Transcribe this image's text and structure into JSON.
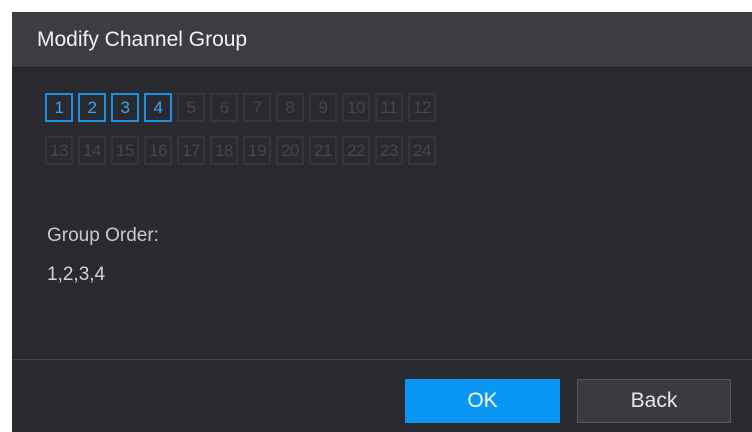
{
  "dialog": {
    "title": "Modify Channel Group"
  },
  "channels": {
    "row1": [
      {
        "label": "1",
        "selected": true
      },
      {
        "label": "2",
        "selected": true
      },
      {
        "label": "3",
        "selected": true
      },
      {
        "label": "4",
        "selected": true
      },
      {
        "label": "5",
        "selected": false
      },
      {
        "label": "6",
        "selected": false
      },
      {
        "label": "7",
        "selected": false
      },
      {
        "label": "8",
        "selected": false
      },
      {
        "label": "9",
        "selected": false
      },
      {
        "label": "10",
        "selected": false
      },
      {
        "label": "11",
        "selected": false
      },
      {
        "label": "12",
        "selected": false
      }
    ],
    "row2": [
      {
        "label": "13",
        "selected": false
      },
      {
        "label": "14",
        "selected": false
      },
      {
        "label": "15",
        "selected": false
      },
      {
        "label": "16",
        "selected": false
      },
      {
        "label": "17",
        "selected": false
      },
      {
        "label": "18",
        "selected": false
      },
      {
        "label": "19",
        "selected": false
      },
      {
        "label": "20",
        "selected": false
      },
      {
        "label": "21",
        "selected": false
      },
      {
        "label": "22",
        "selected": false
      },
      {
        "label": "23",
        "selected": false
      },
      {
        "label": "24",
        "selected": false
      }
    ]
  },
  "group_order": {
    "label": "Group Order:",
    "value": "1,2,3,4"
  },
  "buttons": {
    "ok": "OK",
    "back": "Back"
  },
  "colors": {
    "accent": "#0a97f3",
    "selected_border": "#1e8fe0",
    "background": "#282a30",
    "title_bar": "#3b3d43"
  }
}
